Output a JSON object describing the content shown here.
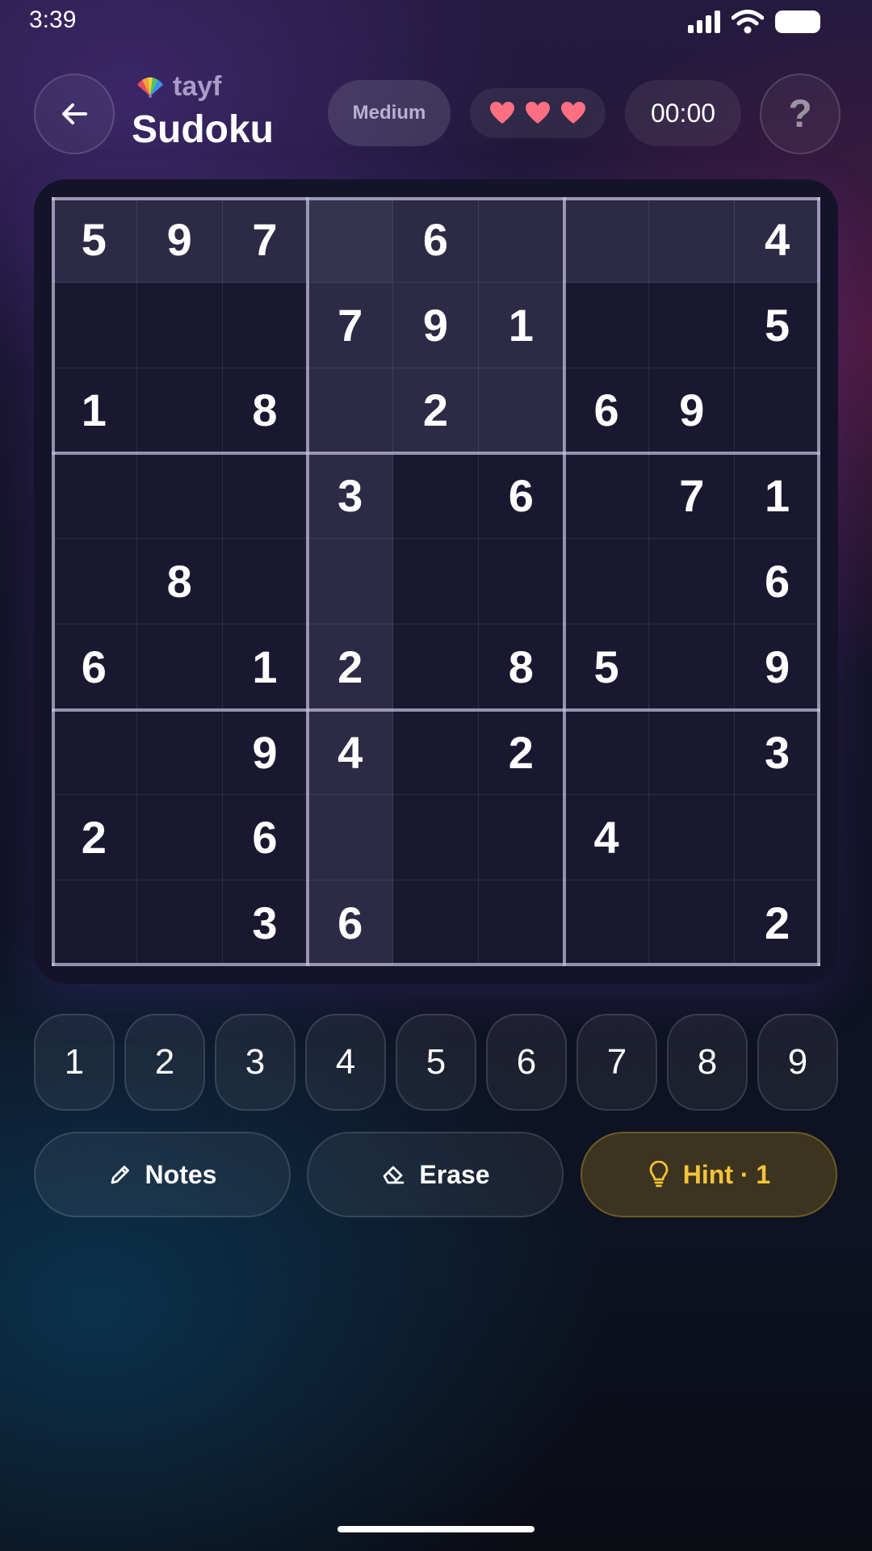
{
  "status_bar": {
    "time": "3:39"
  },
  "header": {
    "brand": "tayf",
    "title": "Sudoku",
    "difficulty": "Medium",
    "lives": 3,
    "timer": "00:00",
    "help": "?"
  },
  "board": {
    "grid": [
      [
        "5",
        "9",
        "7",
        "",
        "6",
        "",
        "",
        "",
        "4"
      ],
      [
        "",
        "",
        "",
        "7",
        "9",
        "1",
        "",
        "",
        "5"
      ],
      [
        "1",
        "",
        "8",
        "",
        "2",
        "",
        "6",
        "9",
        ""
      ],
      [
        "",
        "",
        "",
        "3",
        "",
        "6",
        "",
        "7",
        "1"
      ],
      [
        "",
        "8",
        "",
        "",
        "",
        "",
        "",
        "",
        "6"
      ],
      [
        "6",
        "",
        "1",
        "2",
        "",
        "8",
        "5",
        "",
        "9"
      ],
      [
        "",
        "",
        "9",
        "4",
        "",
        "2",
        "",
        "",
        "3"
      ],
      [
        "2",
        "",
        "6",
        "",
        "",
        "",
        "4",
        "",
        ""
      ],
      [
        "",
        "",
        "3",
        "6",
        "",
        "",
        "",
        "",
        "2"
      ]
    ]
  },
  "numpad": [
    "1",
    "2",
    "3",
    "4",
    "5",
    "6",
    "7",
    "8",
    "9"
  ],
  "actions": {
    "notes_label": "Notes",
    "erase_label": "Erase",
    "hint_label": "Hint · 1"
  },
  "colors": {
    "heart": "#ff6f82",
    "hint_text": "#f6c338",
    "board_bg": "#1a1831",
    "highlight": "#2d2a46"
  }
}
